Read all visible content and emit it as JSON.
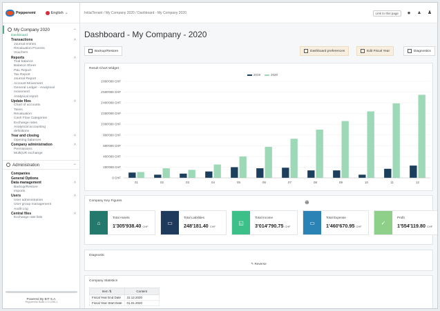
{
  "app": {
    "logo_text": "Pepperemi",
    "language": "English"
  },
  "sidebar": {
    "company": "My Company 2020",
    "items": {
      "dashboard": "Dashboard",
      "transactions": "Transactions",
      "journal_entries": "Journal entries",
      "revaluation_process": "Revaluation Process",
      "vouchers": "Vouchers",
      "reports": "Reports",
      "trial_balance": "Trial balance",
      "balance_sheet": "Balance Sheet",
      "pl_report": "P&L Report",
      "tax_report": "Tax Report",
      "journal_report": "Journal Report",
      "account_movement": "Account Movement",
      "general_ledger_1": "General Ledger - Analytical",
      "general_ledger_2": "movement",
      "analytical_report": "Analytical report",
      "update_files": "Update files",
      "chart_of_accounts": "Chart of accounts",
      "taxes": "Taxes",
      "revaluation": "Revaluation",
      "cashflow_categories": "Cash Flow Categories",
      "exchange_rates": "Exchange rates",
      "analytical_accounting_1": "Analytical accounting",
      "analytical_accounting_2": "definitions",
      "year_and_closing": "Year and closing",
      "opening_balances": "Opening balances",
      "company_administration": "Company administration",
      "permissions": "Permissions",
      "multi_exchange": "Multi(UR exchange",
      "administration": "Administration",
      "companies": "Companies",
      "general_options": "General Options",
      "data_management": "Data management",
      "backup_restore": "Backup/Restore",
      "imports": "Imports",
      "users": "Users",
      "user_administration": "User administration",
      "user_group_management": "User group management",
      "audit_log": "Audit Log",
      "central_files": "Central files",
      "exchange_rate_lists": "Exchange rate lists"
    },
    "powered_by": "Powered By BIT S.A.",
    "build": "Pepperemi Build 1.0.1335.1"
  },
  "topbar": {
    "breadcrumb": "InitialTenant / My Company 2020 / Dashboard - My Company 2020",
    "link_button": "Link to this page"
  },
  "page": {
    "title": "Dashboard - My Company - 2020"
  },
  "toolbar": {
    "backup_restore": "Backup/Restore",
    "dashboard_preferences": "Dashboard preferences",
    "edit_fiscal_year": "Edit Fiscal Year",
    "diagnostics": "Diagnostics"
  },
  "chart_panel": {
    "title": "Result Chart Widget"
  },
  "chart_data": {
    "type": "bar",
    "categories": [
      "01",
      "02",
      "03",
      "04",
      "05",
      "06",
      "07",
      "08",
      "09",
      "10",
      "11",
      "12"
    ],
    "series": [
      {
        "name": "2019",
        "color": "#1d3f5e",
        "values": [
          100000,
          60000,
          80000,
          120000,
          200000,
          180000,
          190000,
          140000,
          140000,
          60000,
          170000,
          230000
        ]
      },
      {
        "name": "2020",
        "color": "#9dd9b6",
        "values": [
          110000,
          180000,
          150000,
          250000,
          400000,
          580000,
          730000,
          900000,
          1060000,
          1240000,
          1390000,
          1550000
        ]
      }
    ],
    "ylim": [
      0,
      1600000
    ],
    "yticks": [
      "0 CHF",
      "200'000 CHF",
      "400'000 CHF",
      "600'000 CHF",
      "800'000 CHF",
      "1'000'000 CHF",
      "1'200'000 CHF",
      "1'400'000 CHF",
      "1'600'000 CHF",
      "1'800'000 CHF"
    ],
    "grid": true,
    "legend": "top-center"
  },
  "key_figures": {
    "title": "Company Key Figures",
    "cards": [
      {
        "label": "Total Assets",
        "value": "1'305'938.40",
        "unit": "CHF",
        "color": "#22796c"
      },
      {
        "label": "Total Liabilities",
        "value": "248'181.40",
        "unit": "CHF",
        "color": "#1e3a5c"
      },
      {
        "label": "Total Income",
        "value": "3'014'790.75",
        "unit": "CHF",
        "color": "#3dbf8a"
      },
      {
        "label": "Total Expense",
        "value": "1'460'670.95",
        "unit": "CHF",
        "color": "#2b82b5"
      },
      {
        "label": "Profit",
        "value": "1'554'119.80",
        "unit": "CHF",
        "color": "#8ed08a"
      }
    ]
  },
  "diagnostics_panel": {
    "title": "Diagnostic",
    "reverse": "Reverse"
  },
  "statistics": {
    "title": "Company Statistics",
    "columns": [
      "Item",
      "Content"
    ],
    "rows": [
      [
        "Fiscal Year End Date",
        "31.12.2020"
      ],
      [
        "Fiscal Year Start Date",
        "01.01.2020"
      ]
    ]
  }
}
